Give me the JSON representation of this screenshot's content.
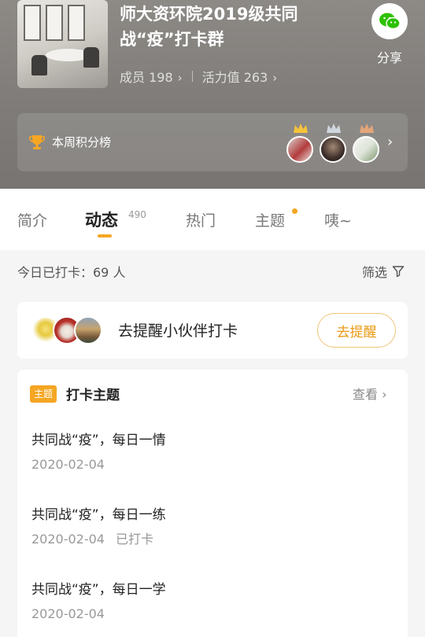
{
  "header": {
    "title_line1": "师大资环院2019级共同",
    "title_line2": "战“疫”打卡群",
    "members_label": "成员 198",
    "activity_label": "活力值 263",
    "share_label": "分享",
    "rank_label": "本周积分榜"
  },
  "tabs": [
    {
      "label": "简介"
    },
    {
      "label": "动态",
      "count": "490",
      "active": true
    },
    {
      "label": "热门"
    },
    {
      "label": "主题",
      "dot": true
    },
    {
      "label": "咦~"
    }
  ],
  "summary": {
    "checkin_text": "今日已打卡：69 人",
    "filter_label": "筛选"
  },
  "remind": {
    "text": "去提醒小伙伴打卡",
    "button_label": "去提醒"
  },
  "topics": {
    "badge": "主题",
    "title": "打卡主题",
    "more_label": "查看",
    "items": [
      {
        "name": "共同战“疫”，每日一情",
        "date": "2020-02-04",
        "status": ""
      },
      {
        "name": "共同战“疫”，每日一练",
        "date": "2020-02-04",
        "status": "已打卡"
      },
      {
        "name": "共同战“疫”，每日一学",
        "date": "2020-02-04",
        "status": ""
      }
    ]
  },
  "colors": {
    "accent": "#f5a623",
    "remind_button_text": "#e89a12",
    "wechat_green": "#2dc100"
  },
  "icons": [
    "wechat-icon",
    "trophy-icon",
    "crown-icon",
    "filter-icon",
    "chevron-right-icon"
  ]
}
